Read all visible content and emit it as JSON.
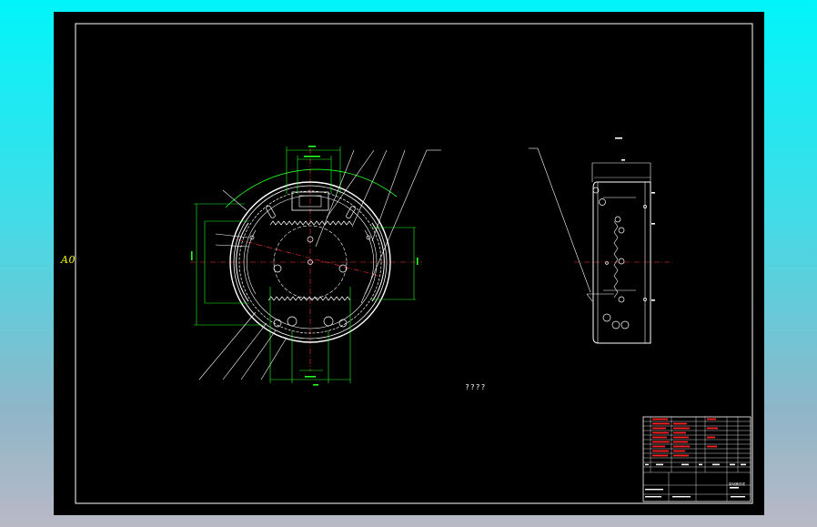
{
  "colors": {
    "sheet_background": "#000000",
    "border": "#ffffff",
    "outline": "#ffffff",
    "dimension": "#22ff22",
    "centerline": "#ff3333",
    "paper_size": "#ffff00",
    "requirements_text": "#22ff22",
    "title_block_red": "#ff2222"
  },
  "sheet": {
    "paper_size": "A0"
  },
  "technical_requirements": {
    "title": "????"
  },
  "title_block": {
    "drawing_name": "制动器总成"
  }
}
